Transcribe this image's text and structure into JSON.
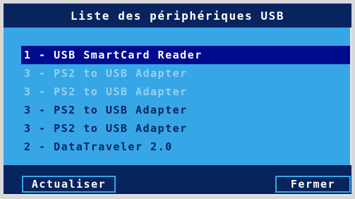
{
  "dialog": {
    "title": "Liste des périphériques USB"
  },
  "devices": [
    {
      "label": "1 - USB SmartCard Reader",
      "state": "selected"
    },
    {
      "label": "3 - PS2 to USB Adapter",
      "state": "disabled"
    },
    {
      "label": "3 - PS2 to USB Adapter",
      "state": "disabled"
    },
    {
      "label": "3 - PS2 to USB Adapter",
      "state": "normal"
    },
    {
      "label": "3 - PS2 to USB Adapter",
      "state": "normal"
    },
    {
      "label": "2 - DataTraveler 2.0",
      "state": "normal"
    }
  ],
  "buttons": {
    "refresh_label": "Actualiser",
    "close_label": "Fermer"
  },
  "colors": {
    "background": "#36a6e6",
    "title_bar": "#08245e",
    "selection": "#000a8c",
    "text": "#08245e",
    "disabled_text": "#96d0f0",
    "selected_text": "#ffffff"
  }
}
